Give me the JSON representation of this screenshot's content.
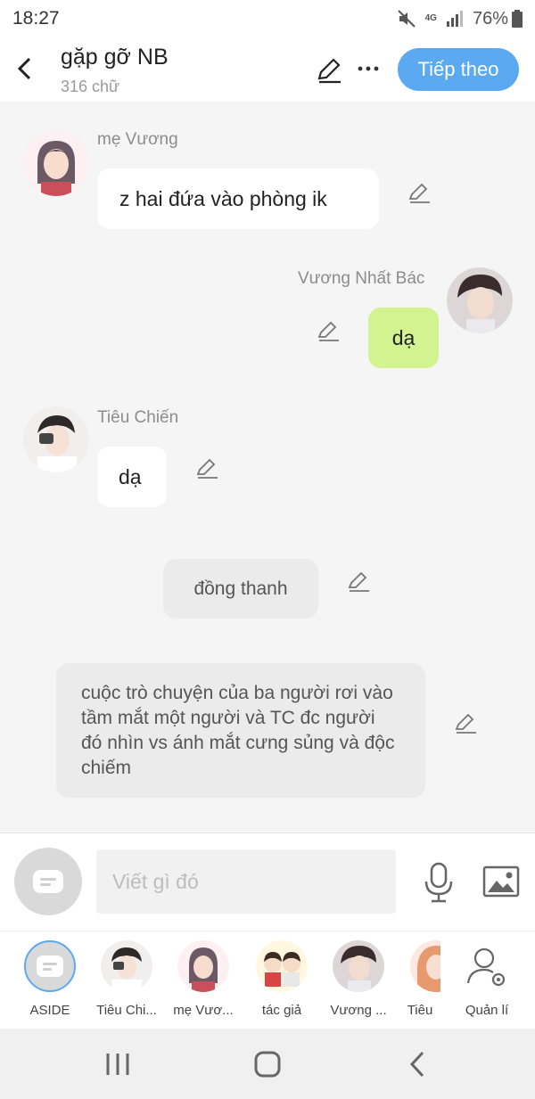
{
  "status": {
    "time": "18:27",
    "network": "4G",
    "battery": "76%"
  },
  "header": {
    "title": "gặp gỡ NB",
    "subtitle": "316 chữ",
    "next_label": "Tiếp theo"
  },
  "messages": [
    {
      "sender": "mẹ Vương",
      "text": "z hai đứa vào phòng ik"
    },
    {
      "sender": "Vương Nhất Bác",
      "text": "dạ"
    },
    {
      "sender": "Tiêu Chiến",
      "text": "dạ"
    },
    {
      "sender": "",
      "text": "đồng thanh"
    },
    {
      "sender": "",
      "text": "cuộc trò chuyện của ba người rơi vào tầm mắt một người và TC đc người đó nhìn vs ánh mắt cưng sủng và độc chiếm"
    }
  ],
  "composer": {
    "placeholder": "Viết gì đó"
  },
  "characters": [
    {
      "label": "ASIDE"
    },
    {
      "label": "Tiêu Chi..."
    },
    {
      "label": "mẹ Vươ..."
    },
    {
      "label": "tác giả"
    },
    {
      "label": "Vương ..."
    },
    {
      "label": "Tiêu"
    },
    {
      "label": "Quản lí"
    }
  ],
  "colors": {
    "accent": "#5aa9f1",
    "green_bubble": "#d3f290",
    "background": "#f5f5f5"
  },
  "icons": [
    "back-icon",
    "pencil-icon",
    "more-icon",
    "aside-icon",
    "mic-icon",
    "image-icon",
    "manage-icon",
    "recents-icon",
    "home-icon",
    "nav-back-icon"
  ]
}
